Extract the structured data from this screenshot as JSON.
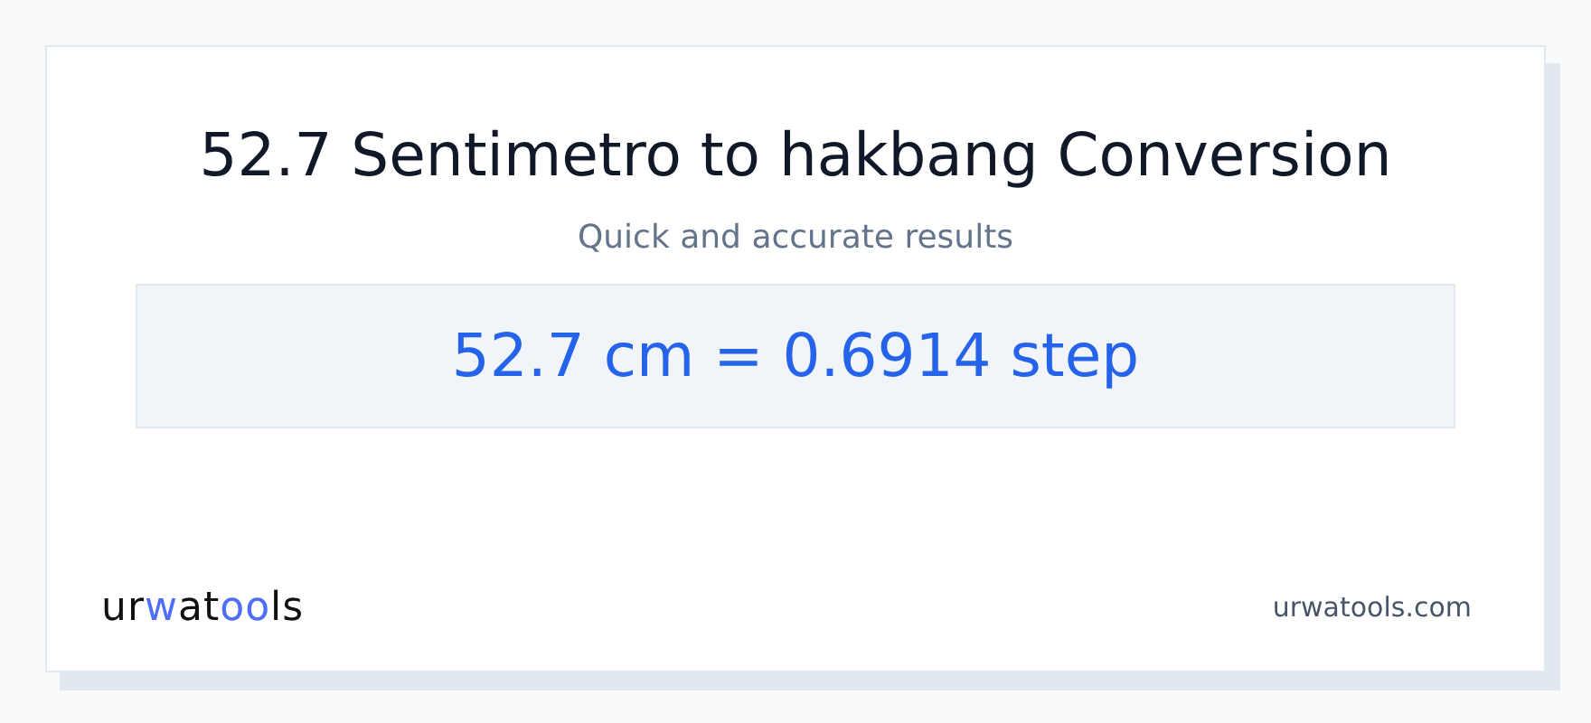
{
  "title": "52.7 Sentimetro to hakbang Conversion",
  "subtitle": "Quick and accurate results",
  "result": "52.7 cm = 0.6914 step",
  "logo": [
    {
      "text": "ur",
      "accent": false
    },
    {
      "text": "w",
      "accent": true
    },
    {
      "text": "at",
      "accent": false
    },
    {
      "text": "oo",
      "accent": true
    },
    {
      "text": "ls",
      "accent": false
    }
  ],
  "site": "urwatools.com"
}
